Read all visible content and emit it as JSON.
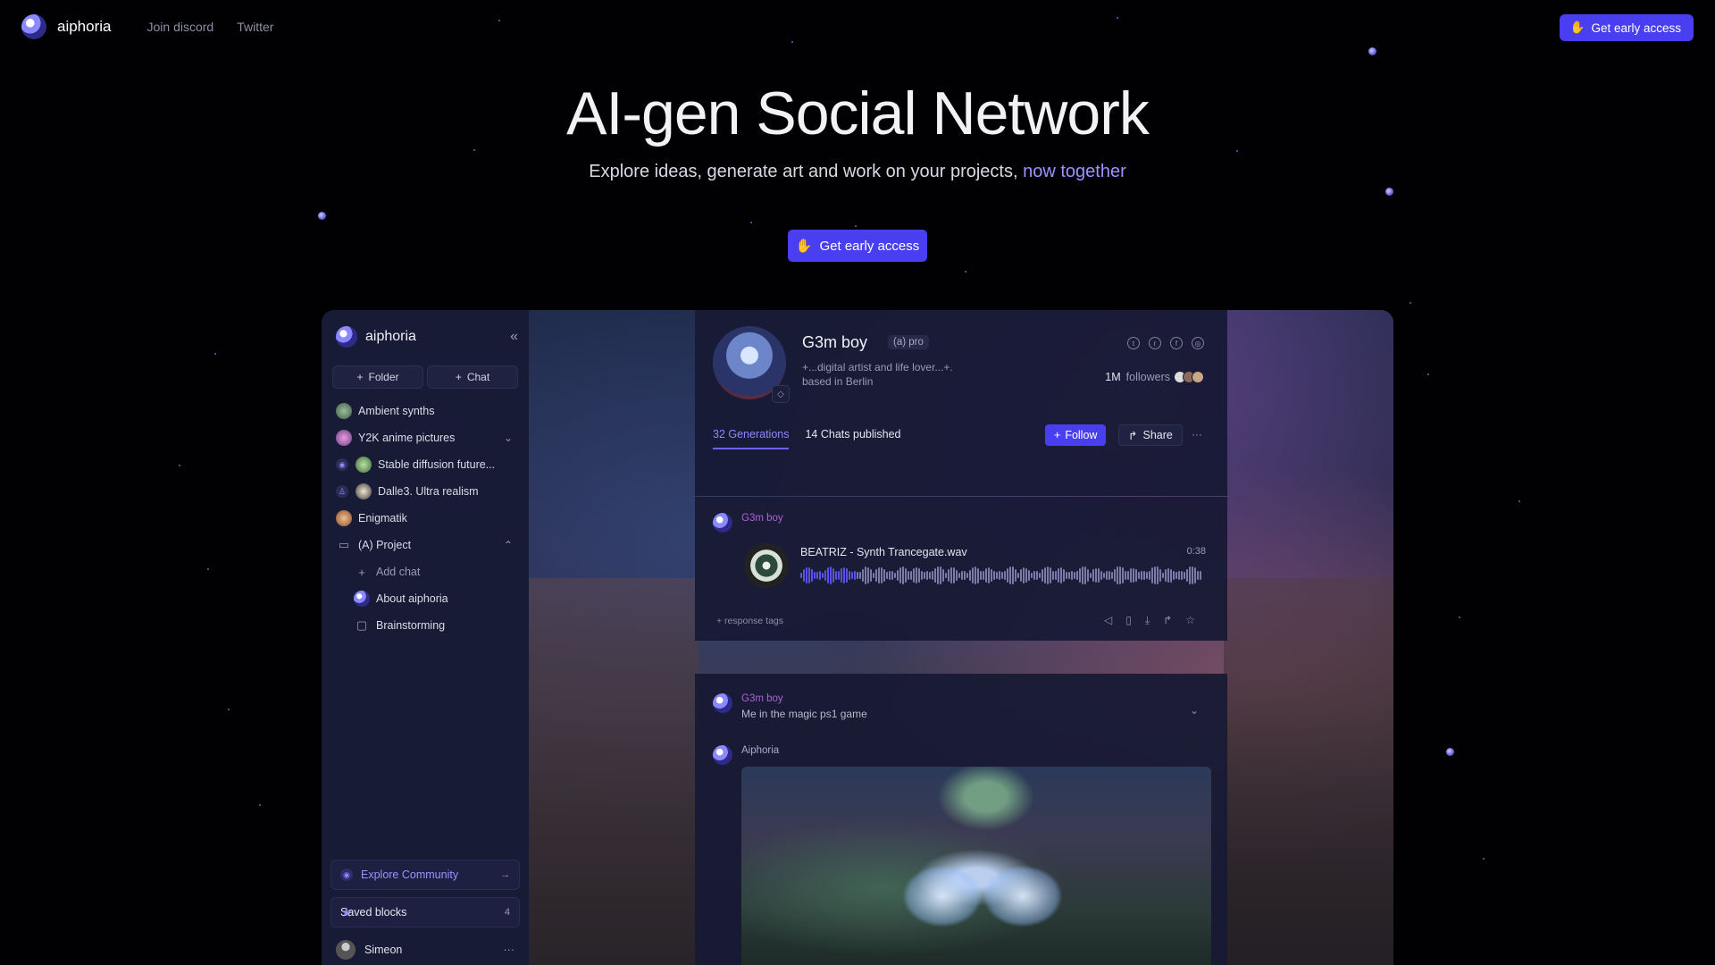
{
  "nav": {
    "brand": "aiphoria",
    "links": [
      "Join discord",
      "Twitter"
    ],
    "cta": "Get early access"
  },
  "hero": {
    "title": "AI-gen Social Network",
    "subtitle": "Explore ideas, generate art and work on your projects,",
    "subtitle_accent": "now together",
    "cta": "Get early access"
  },
  "colors": {
    "accent": "#4a3ff0",
    "accent_text": "#9b93ff",
    "background": "#010103",
    "panel": "#181b36"
  },
  "sidebar": {
    "brand": "aiphoria",
    "actions": {
      "folder": "Folder",
      "chat": "Chat"
    },
    "items": [
      {
        "label": "Ambient synths"
      },
      {
        "label": "Y2K anime pictures"
      },
      {
        "label": "Stable diffusion future..."
      },
      {
        "label": "Dalle3. Ultra realism"
      },
      {
        "label": "Enigmatik"
      },
      {
        "label": "(A) Project"
      },
      {
        "label": "Add chat"
      },
      {
        "label": "About aiphoria"
      },
      {
        "label": "Brainstorming"
      }
    ],
    "explore": "Explore Community",
    "saved": {
      "label": "Saved blocks",
      "count": "4"
    },
    "user": "Simeon"
  },
  "profile": {
    "name": "G3m boy",
    "tag": "(a) pro",
    "bio_line1": "+...digital artist and life lover...+.",
    "bio_line2": "based in Berlin",
    "followers_count": "1M",
    "followers_label": "followers",
    "tabs": [
      "32 Generations",
      "14 Chats published"
    ],
    "follow": "Follow",
    "share": "Share"
  },
  "post1": {
    "author": "G3m boy",
    "track": "BEATRIZ - Synth Trancegate.wav",
    "duration": "0:38",
    "progress": 0.14,
    "response_tags": "+ response tags"
  },
  "post2": {
    "author": "G3m boy",
    "text": "Me in the magic ps1 game",
    "ai_author": "Aiphoria"
  }
}
